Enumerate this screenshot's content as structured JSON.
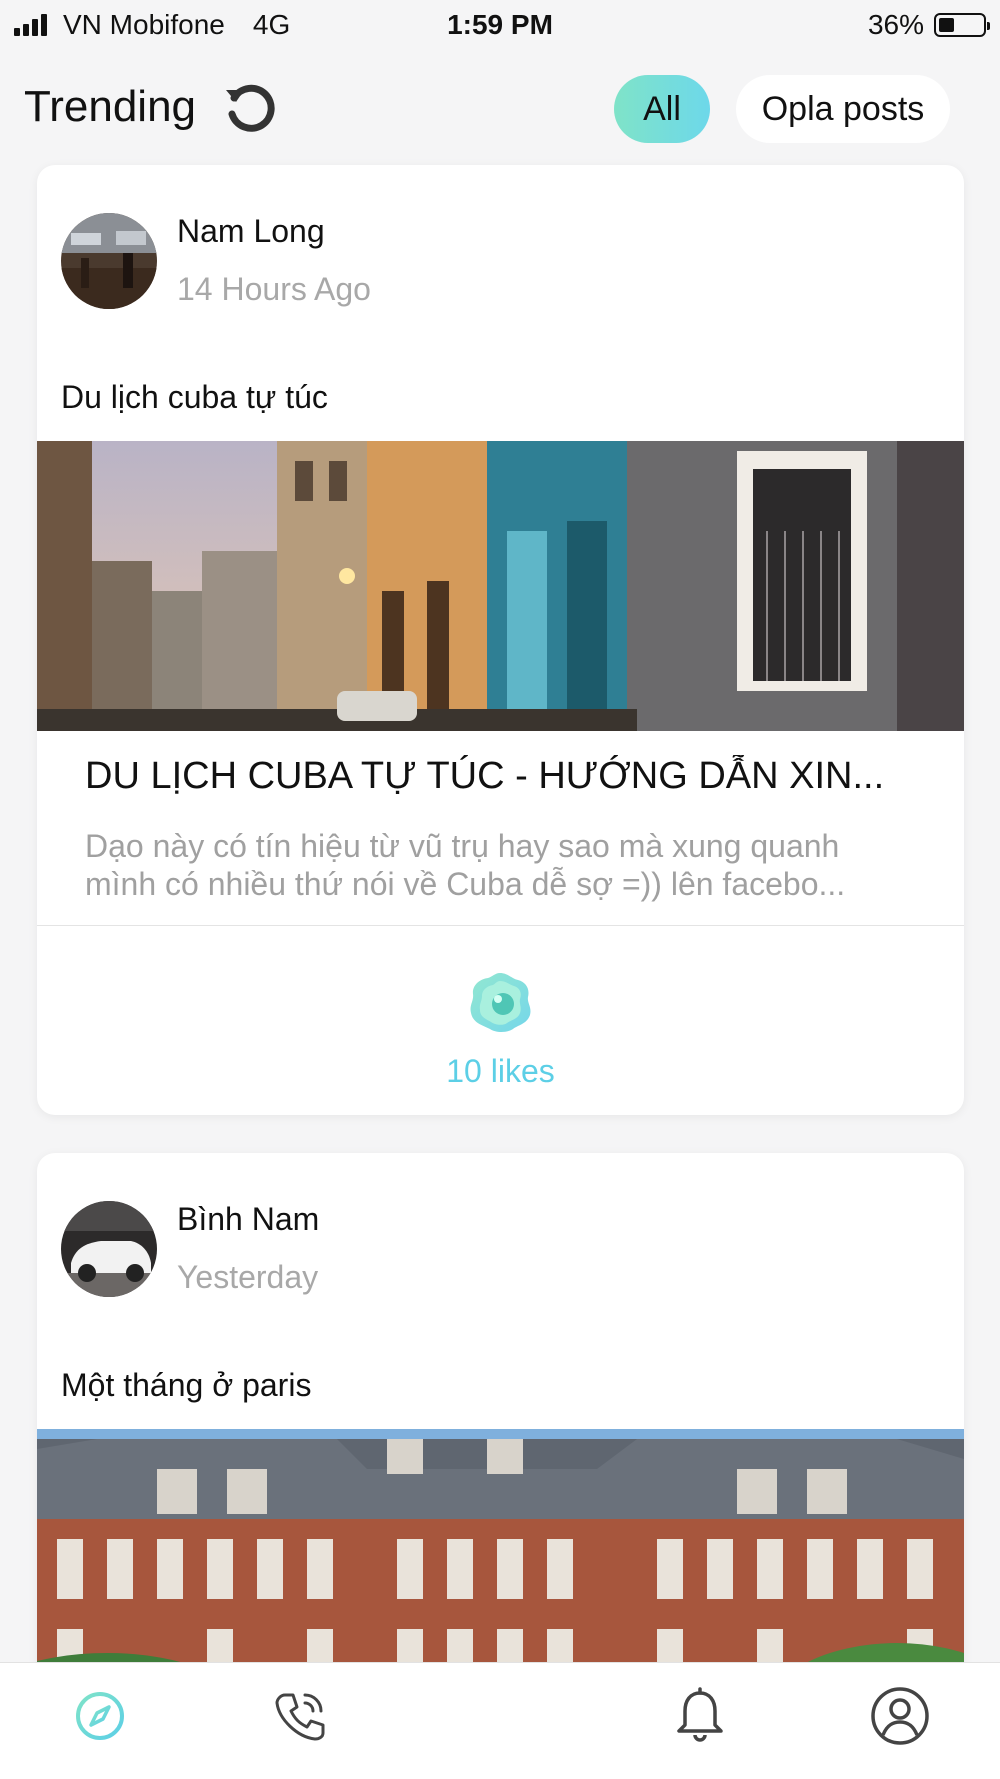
{
  "status": {
    "carrier": "VN Mobifone",
    "network": "4G",
    "time": "1:59 PM",
    "battery": "36%",
    "battery_level": 0.36
  },
  "header": {
    "title": "Trending",
    "filters": {
      "all": "All",
      "opla": "Opla posts"
    }
  },
  "posts": [
    {
      "author": "Nam Long",
      "time": "14 Hours Ago",
      "caption": "Du lịch cuba tự túc",
      "link_title": "DU LỊCH CUBA TỰ TÚC - HƯỚNG DẪN XIN...",
      "link_desc": "Dạo này có tín hiệu từ vũ trụ hay sao mà xung quanh mình có nhiều thứ nói về Cuba dễ sợ =)) lên facebo...",
      "likes": "10 likes"
    },
    {
      "author": "Bình Nam",
      "time": "Yesterday",
      "caption": "Một tháng ở paris"
    }
  ],
  "colors": {
    "accent": "#5ccfe6",
    "accent_green": "#7fe3c8",
    "muted": "#a8a8a8"
  },
  "icons": [
    "refresh-icon",
    "like-icon",
    "explore-icon",
    "phone-icon",
    "add-icon",
    "bell-icon",
    "profile-icon"
  ]
}
